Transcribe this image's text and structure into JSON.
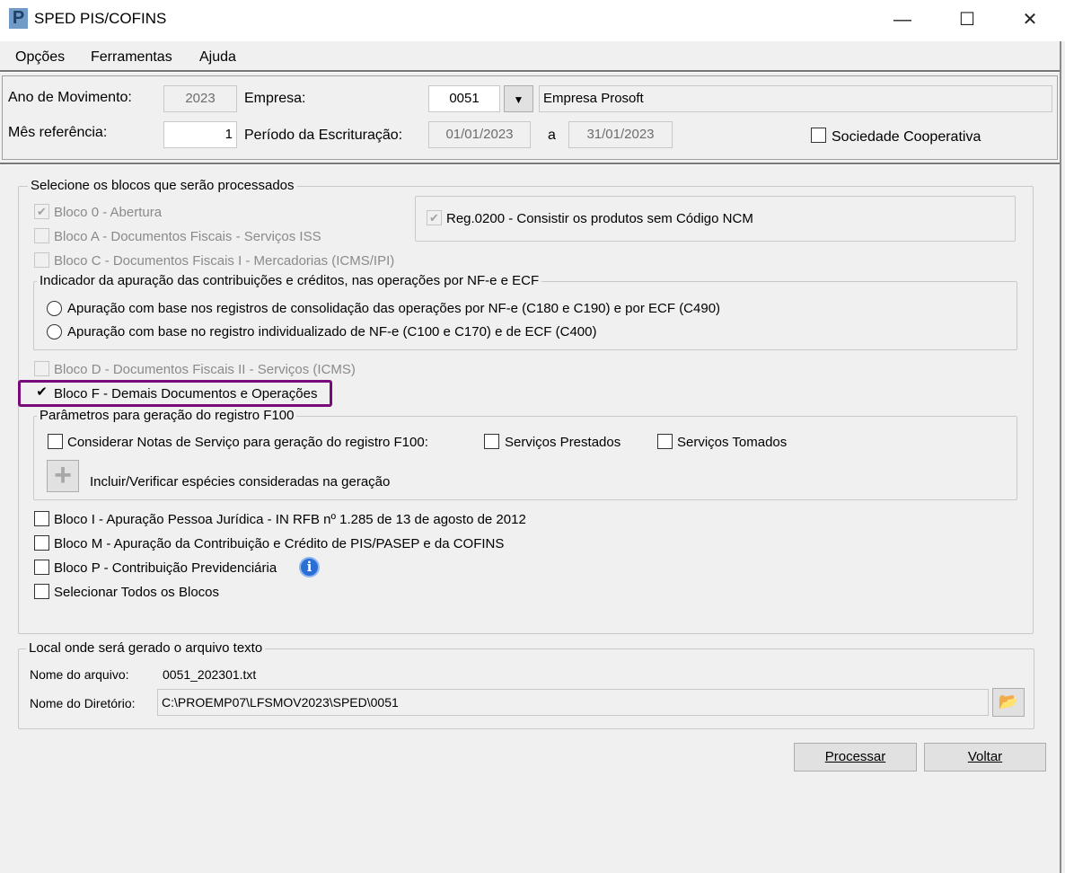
{
  "window": {
    "title": "SPED PIS/COFINS",
    "logo": "P",
    "minimize": "—",
    "maximize": "☐",
    "close": "✕"
  },
  "menu": [
    "Opções",
    "Ferramentas",
    "Ajuda"
  ],
  "header": {
    "ano_label": "Ano de Movimento:",
    "ano_value": "2023",
    "empresa_label": "Empresa:",
    "empresa_code": "0051",
    "empresa_name": "Empresa Prosoft",
    "mes_label": "Mês referência:",
    "mes_value": "1",
    "periodo_label": "Período da Escrituração:",
    "periodo_inicio": "01/01/2023",
    "periodo_sep": "a",
    "periodo_fim": "31/01/2023",
    "sociedade_label": "Sociedade Cooperativa"
  },
  "blocos": {
    "legend": "Selecione os blocos que serão processados",
    "bloco0": "Bloco 0 - Abertura",
    "blocoA": "Bloco A - Documentos Fiscais - Serviços  ISS",
    "blocoC": "Bloco C - Documentos Fiscais  I - Mercadorias  (ICMS/IPI)",
    "reg0200": "Reg.0200 - Consistir os produtos sem Código NCM",
    "indicador_legend": "Indicador da apuração das contribuições e créditos, nas operações por NF-e e ECF",
    "radio1": "Apuração com base nos registros de consolidação das operações por  NF-e (C180 e C190) e por  ECF (C490)",
    "radio2": "Apuração com base no registro individualizado de NF-e (C100 e C170) e de ECF (C400)",
    "blocoD": "Bloco D - Documentos Fiscais II - Serviços  (ICMS)",
    "blocoF": "Bloco F - Demais Documentos e Operações",
    "f100_legend": "Parâmetros para geração do registro F100",
    "considerar": "Considerar Notas de Serviço para geração do registro F100:",
    "prestados": "Serviços Prestados",
    "tomados": "Serviços Tomados",
    "incluir": "Incluir/Verificar espécies consideradas na geração",
    "blocoI": "Bloco I - Apuração Pessoa Jurídica - IN RFB nº 1.285 de 13 de agosto de 2012",
    "blocoM": "Bloco M - Apuração da Contribuição e Crédito de PIS/PASEP e da COFINS",
    "blocoP": "Bloco P - Contribuição Previdenciária",
    "todos": "Selecionar Todos os Blocos"
  },
  "local": {
    "legend": "Local onde será gerado o arquivo texto",
    "arquivo_label": "Nome do arquivo:",
    "arquivo_value": "0051_202301.txt",
    "dir_label": "Nome do Diretório:",
    "dir_value": "C:\\PROEMP07\\LFSMOV2023\\SPED\\0051"
  },
  "buttons": {
    "processar": "Processar",
    "voltar": "Voltar"
  },
  "colors": {
    "highlight": "#7a0a7a",
    "info": "#2a6fd6"
  }
}
